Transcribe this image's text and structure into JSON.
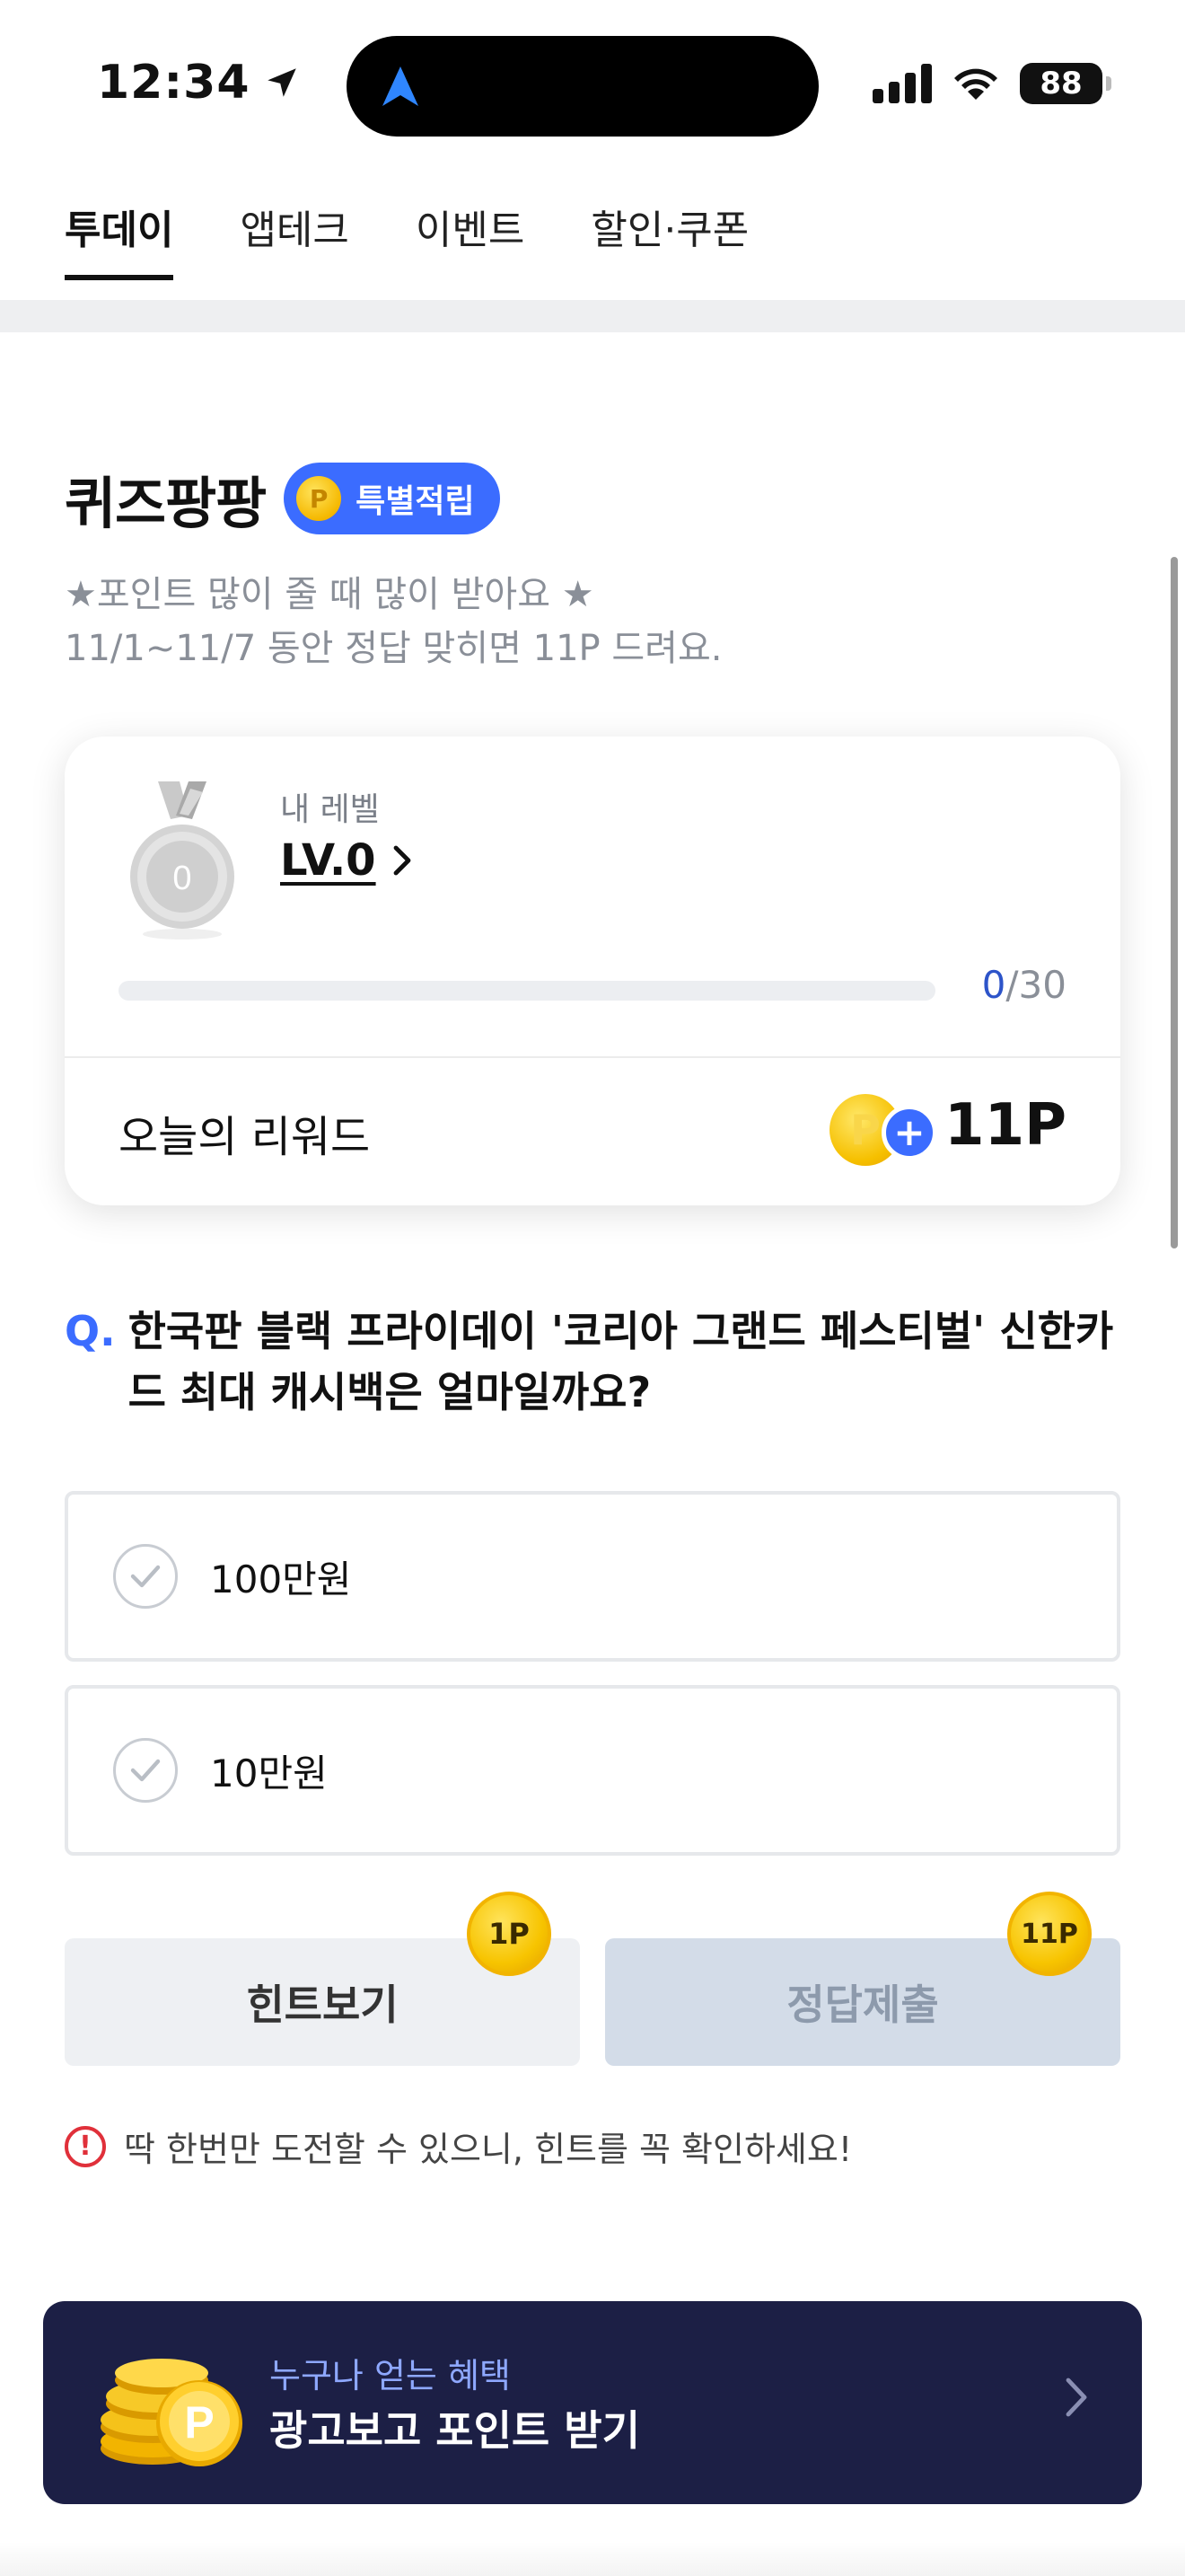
{
  "status_bar": {
    "time": "12:34",
    "battery": "88"
  },
  "tabs": [
    {
      "label": "투데이",
      "active": true
    },
    {
      "label": "앱테크",
      "active": false
    },
    {
      "label": "이벤트",
      "active": false
    },
    {
      "label": "할인·쿠폰",
      "active": false
    }
  ],
  "quiz": {
    "title": "퀴즈팡팡",
    "badge_coin": "P",
    "badge_label": "특별적립",
    "desc_line1": "★포인트 많이 줄 때 많이 받아요 ★",
    "desc_line2": "11/1~11/7 동안 정답 맞히면 11P 드려요."
  },
  "level": {
    "medal_number": "0",
    "label": "내 레벨",
    "value": "LV.0",
    "progress_current": "0",
    "progress_total": "/30",
    "progress_fraction": 0
  },
  "reward": {
    "label": "오늘의 리워드",
    "coin": "P",
    "plus": "+",
    "value": "11P"
  },
  "question": {
    "prefix": "Q.",
    "text": "한국판 블랙 프라이데이 '코리아 그랜드 페스티벌' 신한카드 최대 캐시백은 얼마일까요?"
  },
  "options": [
    {
      "label": "100만원"
    },
    {
      "label": "10만원"
    }
  ],
  "buttons": {
    "hint_label": "힌트보기",
    "hint_cost": "1P",
    "submit_label": "정답제출",
    "submit_reward": "11P"
  },
  "notice": {
    "icon": "!",
    "text": "딱 한번만 도전할 수 있으니, 힌트를 꼭 확인하세요!"
  },
  "ad_banner": {
    "subtitle": "누구나 얻는 혜택",
    "title": "광고보고 포인트 받기",
    "coin_letter": "P"
  },
  "colors": {
    "accent": "#3b6cff",
    "banner_bg": "#1c1f45",
    "coin": "#f6c000"
  },
  "icons": [
    "location-arrow-icon",
    "signal-icon",
    "wifi-icon",
    "battery-icon",
    "medal-icon",
    "chevron-right-icon",
    "coin-icon",
    "check-icon",
    "warning-icon"
  ]
}
